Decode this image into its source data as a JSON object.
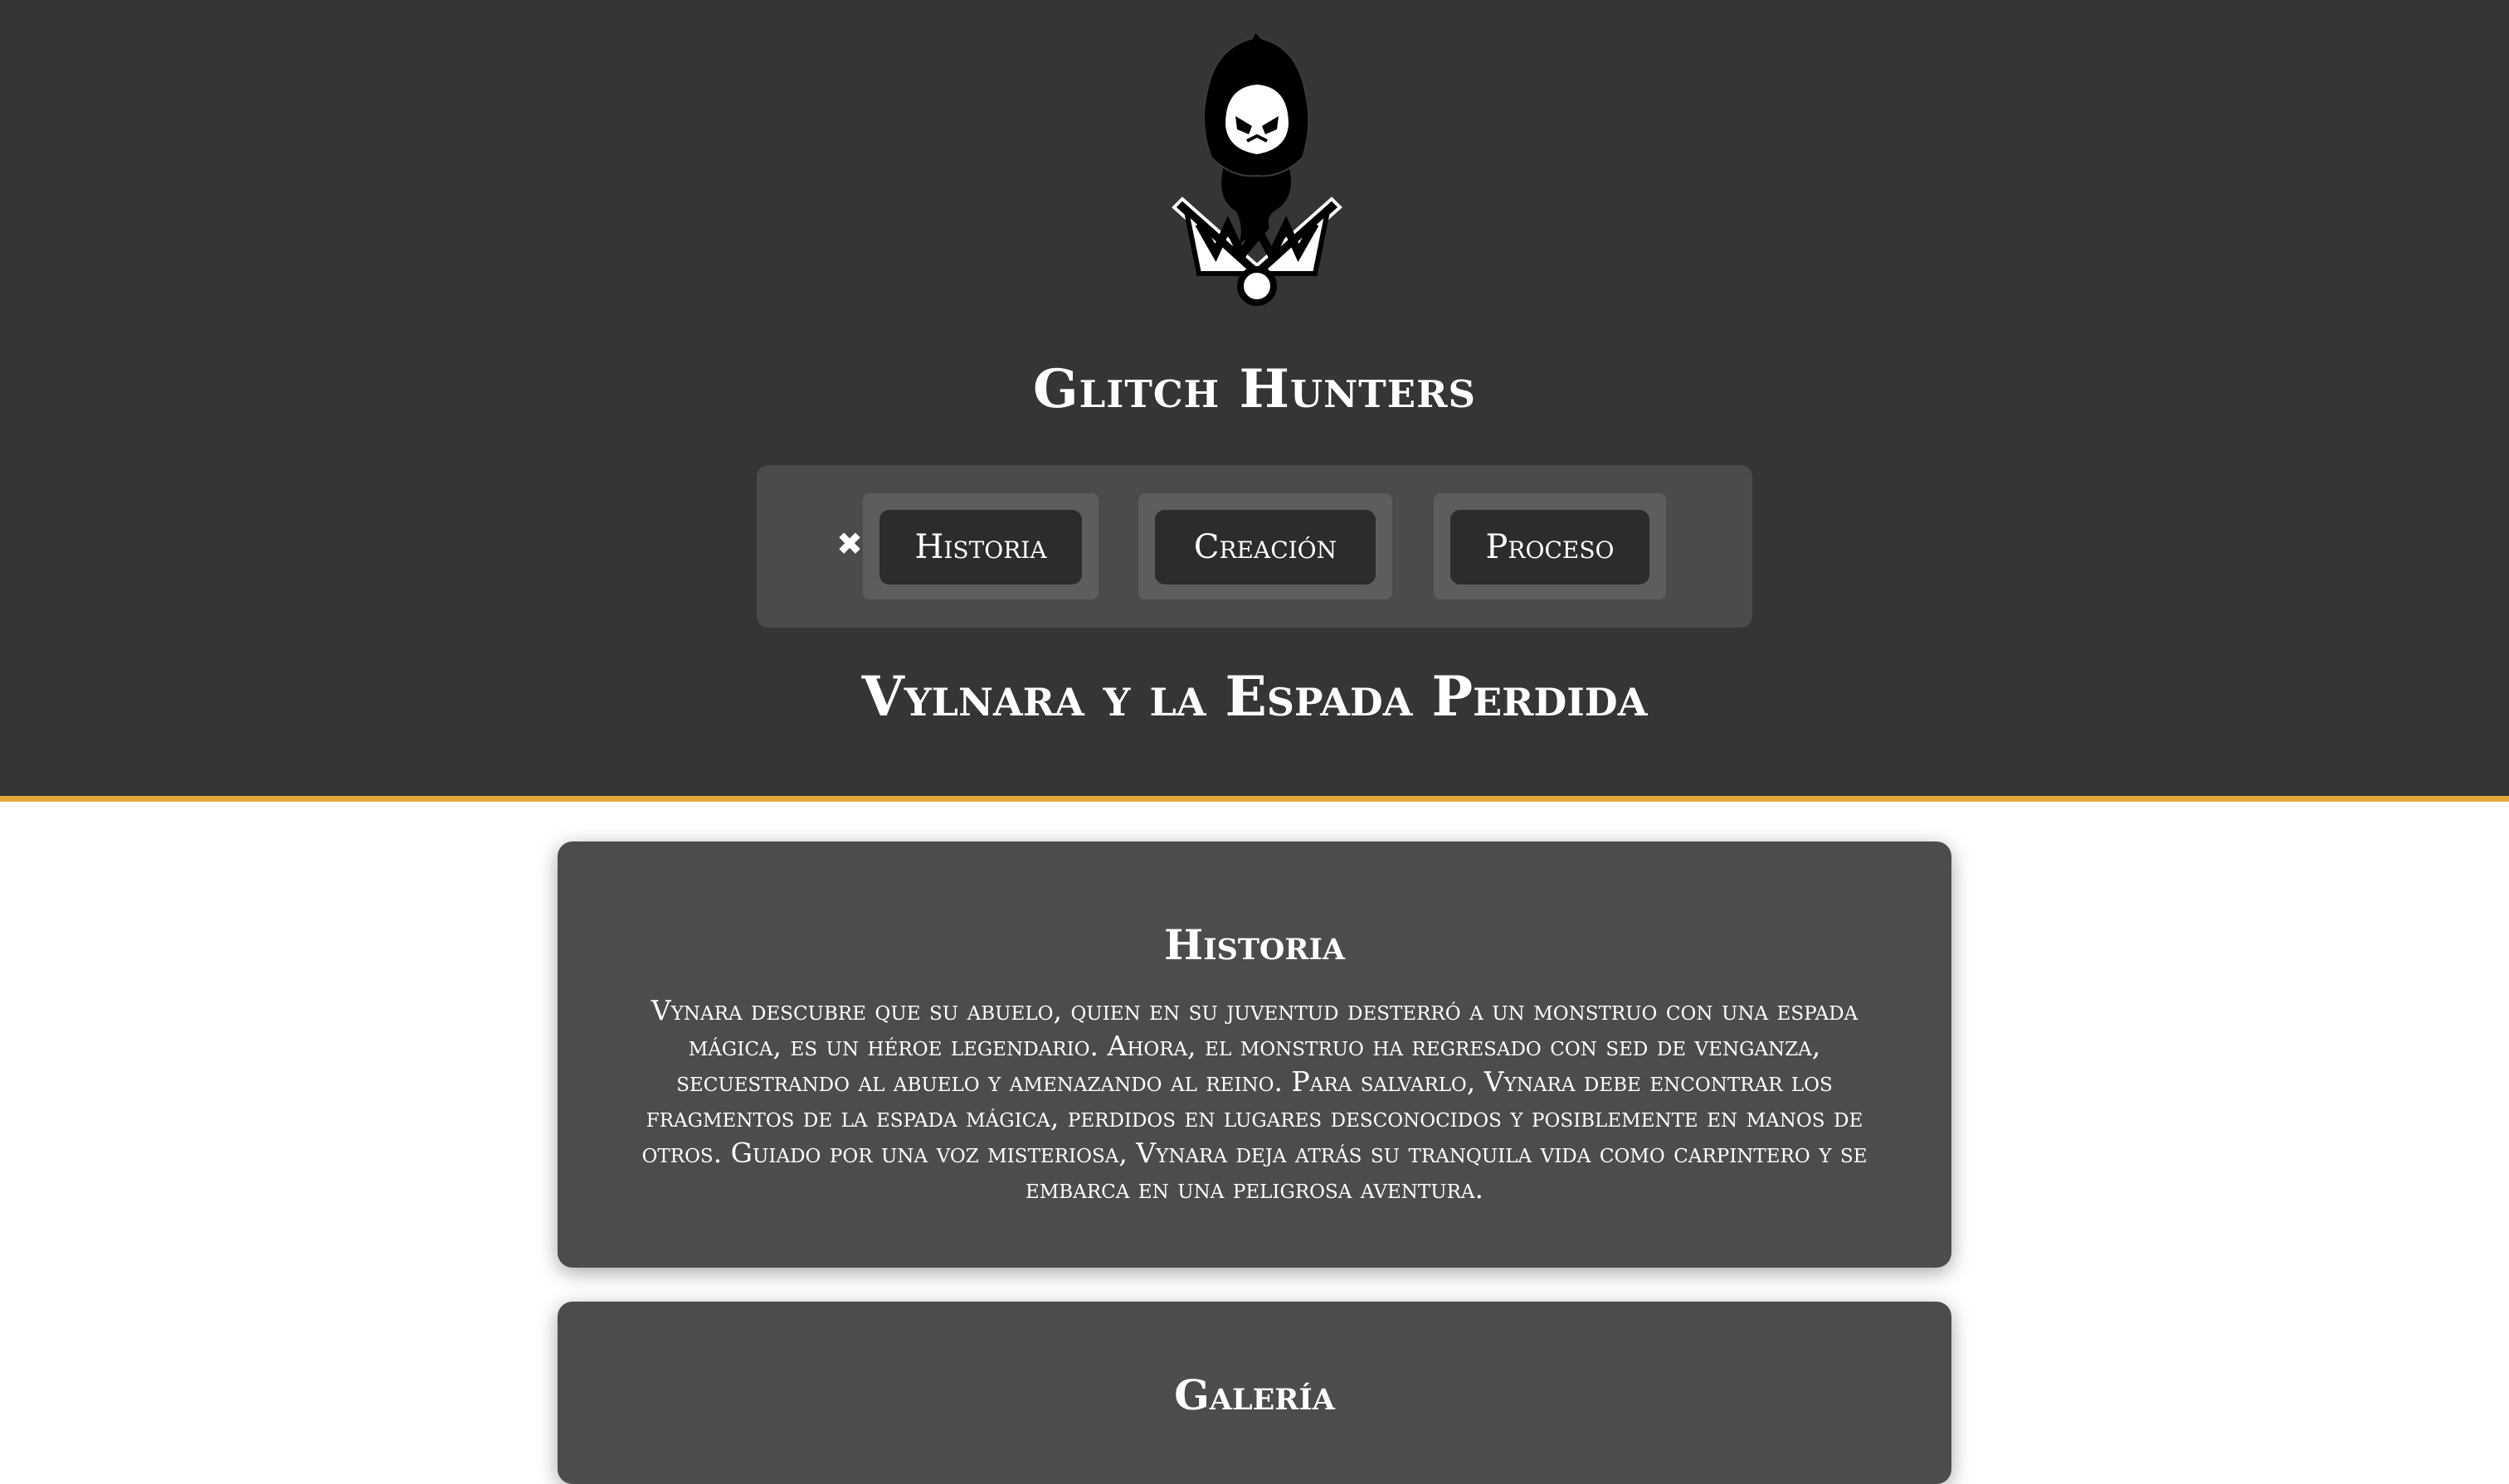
{
  "header": {
    "logo_icon": "hooded-reaper-on-bear-trap-logo",
    "site_title": "Glitch Hunters",
    "story_title": "Vylnara y la Espada Perdida",
    "accent_color": "#e2a93b",
    "background_color": "#353535"
  },
  "nav": {
    "close_symbol": "✖",
    "close_icon": "close-icon",
    "items": [
      {
        "label": "Historia"
      },
      {
        "label": "Creación"
      },
      {
        "label": "Proceso"
      }
    ]
  },
  "sections": {
    "historia": {
      "title": "Historia",
      "text": "Vynara descubre que su abuelo, quien en su juventud desterró a un monstruo con una espada mágica, es un héroe legendario. Ahora, el monstruo ha regresado con sed de venganza, secuestrando al abuelo y amenazando al reino. Para salvarlo, Vynara debe encontrar los fragmentos de la espada mágica, perdidos en lugares desconocidos y posiblemente en manos de otros. Guiado por una voz misteriosa, Vynara deja atrás su tranquila vida como carpintero y se embarca en una peligrosa aventura."
    },
    "galeria": {
      "title": "Galería"
    }
  }
}
